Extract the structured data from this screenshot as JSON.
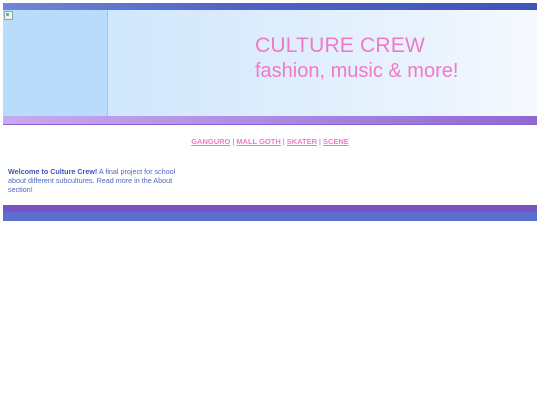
{
  "header": {
    "title": "CULTURE CREW",
    "subtitle": "fashion, music & more!",
    "image_icon": "broken-image-icon"
  },
  "nav": {
    "items": [
      {
        "label": "GANGURO"
      },
      {
        "label": "MALL GOTH"
      },
      {
        "label": "SKATER"
      },
      {
        "label": "SCENE"
      }
    ],
    "separator": "|"
  },
  "intro": {
    "bold": "Welcome to Culture Crew!",
    "text": " A final project for school about different subcultures. Read more in the About section!"
  },
  "colors": {
    "accent_pink": "#f07ac8",
    "text_blue": "#4f66c0",
    "bar_blue": "#4f63c4",
    "bar_purple": "#8e69d2"
  }
}
